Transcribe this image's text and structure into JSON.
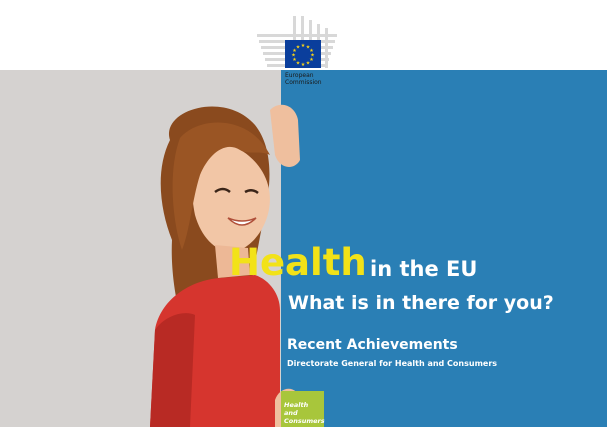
{
  "logo": {
    "line1": "European",
    "line2": "Commission"
  },
  "title": {
    "highlight": "Health",
    "rest": "in the EU",
    "subtitle": "What is in there for you?"
  },
  "section": {
    "heading": "Recent Achievements",
    "department": "Directorate General for Health and Consumers"
  },
  "tab": {
    "line1": "Health and",
    "line2": "Consumers"
  },
  "colors": {
    "blue_panel": "#2a7fb5",
    "grey_panel": "#d5d2d0",
    "highlight_yellow": "#f2e218",
    "green_tab": "#a8c63b",
    "eu_blue": "#0a3e9c",
    "eu_star": "#f8d317"
  },
  "icons": {
    "logo": "eu-commission-building-flag-icon",
    "photo": "smiling-woman-photo"
  }
}
